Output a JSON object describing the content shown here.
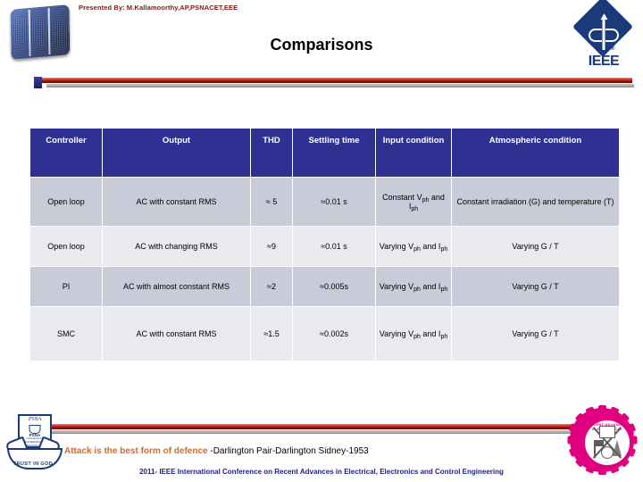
{
  "header": {
    "presented_by": "Presented By: M.Kallamoorthy,AP,PSNACET,EEE",
    "title": "Comparisons",
    "ieee_wordmark": "IEEE",
    "ieee_registered": "®"
  },
  "logos": {
    "solar_cell": "solar-cell-image",
    "college_script": "PSNA",
    "college_name": "PSNA",
    "college_sub": "COLLEGE OF ENGINEERING AND TECHNOLOGY DINDIGUL",
    "college_motto": "TRUST IN GOD",
    "gear_ring_text": "RECENT ADVANCES IN ELECTRICAL"
  },
  "table": {
    "columns": [
      "Controller",
      "Output",
      "THD",
      "Settling time",
      "Input condition",
      "Atmospheric condition"
    ],
    "rows": [
      {
        "controller": "Open loop",
        "output": "AC with constant RMS",
        "thd": "≈ 5",
        "settling_time": "≈0.01 s",
        "input_condition": "Constant V",
        "input_condition_sub1": "ph",
        "input_condition_mid": " and I",
        "input_condition_sub2": "ph",
        "atmospheric": "Constant irradiation (G) and temperature (T)"
      },
      {
        "controller": "Open loop",
        "output": "AC with changing RMS",
        "thd": "≈9",
        "settling_time": "≈0.01 s",
        "input_condition": "Varying V",
        "input_condition_sub1": "ph",
        "input_condition_mid": " and I",
        "input_condition_sub2": "ph",
        "atmospheric": "Varying G / T"
      },
      {
        "controller": "PI",
        "output": "AC with almost constant RMS",
        "thd": "≈2",
        "settling_time": "≈0.005s",
        "input_condition": "Varying V",
        "input_condition_sub1": "ph",
        "input_condition_mid": " and I",
        "input_condition_sub2": "ph",
        "atmospheric": "Varying G / T"
      },
      {
        "controller": "SMC",
        "output": "AC with constant RMS",
        "thd": "≈1.5",
        "settling_time": "≈0.002s",
        "input_condition": "Varying V",
        "input_condition_sub1": "ph",
        "input_condition_mid": " and I",
        "input_condition_sub2": "ph",
        "atmospheric": "Varying G / T"
      }
    ]
  },
  "footer": {
    "quote_text": "Attack is the best form of defence",
    "quote_attribution": " -Darlington Pair-Darlington Sidney-1953",
    "conference": "2011- IEEE International Conference on Recent Advances in Electrical, Electronics and Control Engineering"
  },
  "colors": {
    "header_blue": "#2e3192",
    "row_shade": "#c9ccd8",
    "row_light": "#e9eaee",
    "presented_by_red": "#7d1a14",
    "quote_orange": "#d4692a",
    "conference_navy": "#1b1f8c",
    "ieee_blue": "#1b3a7a",
    "gear_magenta": "#e0007f"
  }
}
